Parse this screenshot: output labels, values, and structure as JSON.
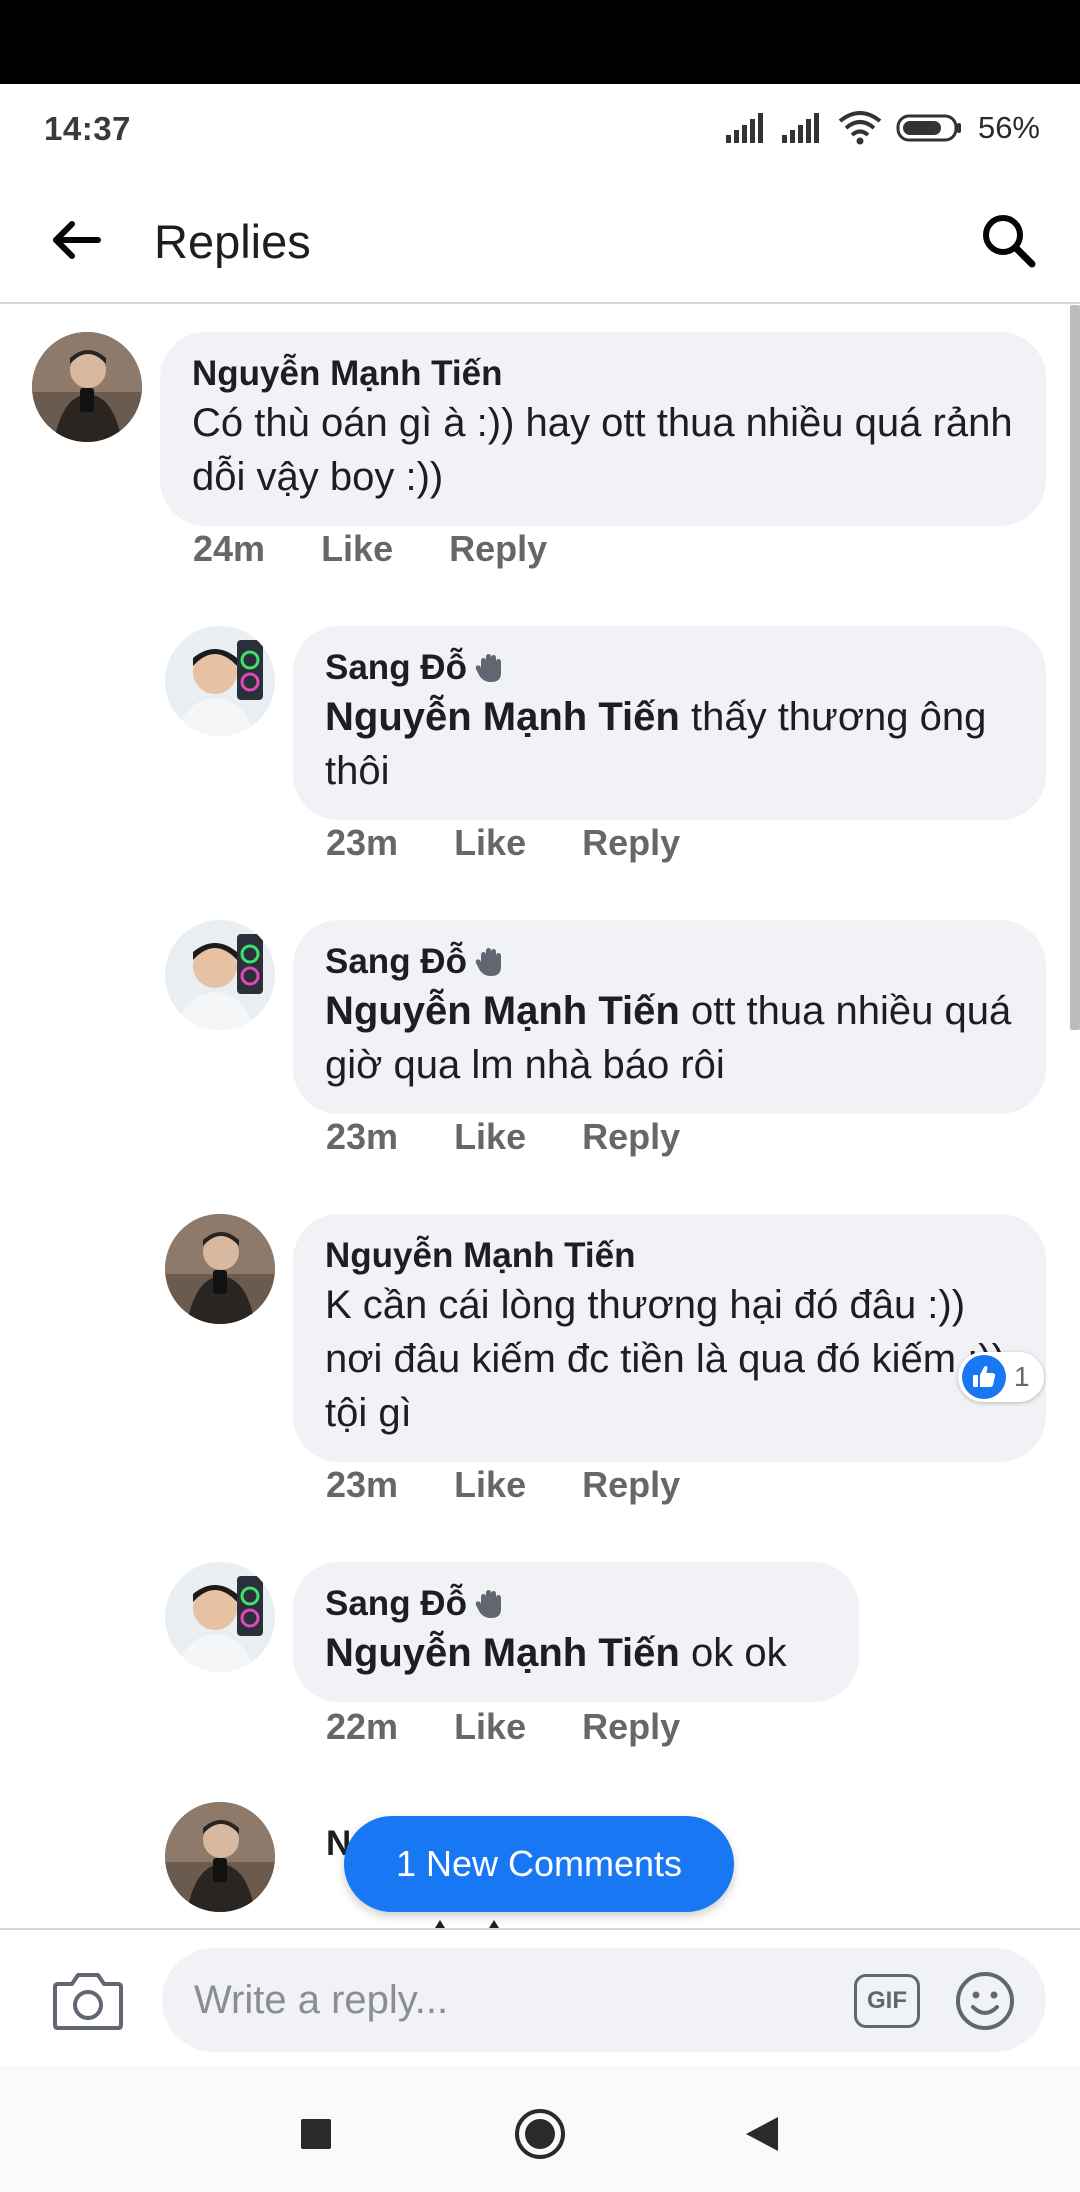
{
  "status_bar": {
    "time": "14:37",
    "battery": "56%"
  },
  "app_bar": {
    "title": "Replies"
  },
  "comments": [
    {
      "author": "Nguyễn Mạnh Tiến",
      "mention": "",
      "text": "Có thù oán gì à :)) hay ott thua nhiều quá rảnh dỗi vậy boy :))",
      "time": "24m",
      "like": "Like",
      "reply": "Reply"
    },
    {
      "author": "Sang Đỗ",
      "mention": "Nguyễn Mạnh Tiến",
      "text": "thấy thương ông thôi",
      "time": "23m",
      "like": "Like",
      "reply": "Reply"
    },
    {
      "author": "Sang Đỗ",
      "mention": "Nguyễn Mạnh Tiến",
      "text": "ott thua nhiều quá giờ qua lm nhà báo rôi",
      "time": "23m",
      "like": "Like",
      "reply": "Reply"
    },
    {
      "author": "Nguyễn Mạnh Tiến",
      "mention": "",
      "text": "K cần cái lòng thương hại đó đâu :)) nơi đâu kiếm đc tiền là qua đó kiếm :)) tội gì",
      "time": "23m",
      "like": "Like",
      "reply": "Reply",
      "reaction_count": "1"
    },
    {
      "author": "Sang Đỗ",
      "mention": "Nguyễn Mạnh Tiến",
      "text": "ok ok",
      "time": "22m",
      "like": "Like",
      "reply": "Reply"
    },
    {
      "author": "N",
      "mention": "",
      "text": "",
      "time": "",
      "like": "",
      "reply": ""
    }
  ],
  "new_comments": "1 New Comments",
  "composer": {
    "placeholder": "Write a reply...",
    "gif_label": "GIF"
  },
  "icons": {
    "back": "arrow-left-icon",
    "search": "search-icon",
    "camera": "camera-icon",
    "emoji": "smiley-icon",
    "like": "thumbs-up-icon",
    "wave": "wave-hand-icon"
  },
  "colors": {
    "accent": "#1877f2",
    "bubble": "#f0f2f5",
    "meta": "#65676b"
  }
}
